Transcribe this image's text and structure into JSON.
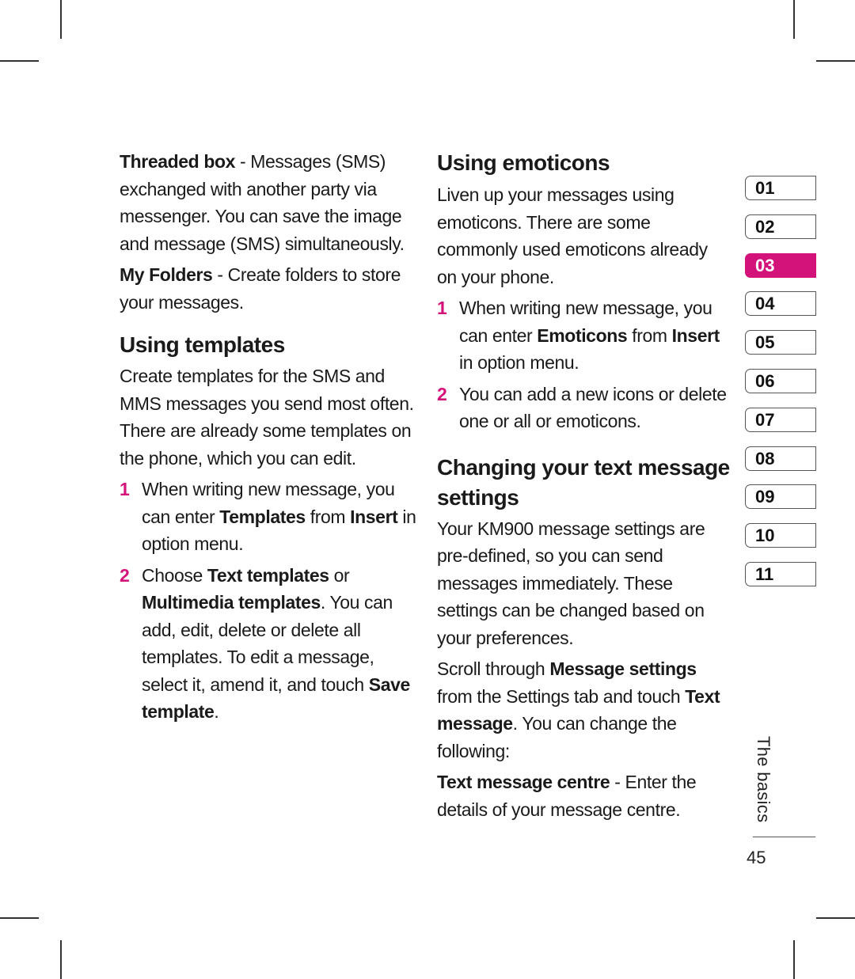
{
  "left_column": {
    "threaded_box": {
      "term": "Threaded box",
      "text": " - Messages (SMS) exchanged with another party via messenger. You can save the image and message (SMS) simultaneously."
    },
    "my_folders": {
      "term": "My Folders",
      "text": " - Create folders to store your messages."
    },
    "templates_heading": "Using templates",
    "templates_intro": "Create templates for the SMS and MMS messages you send most often. There are already some templates on the phone, which you can edit.",
    "steps": [
      {
        "num": "1",
        "a": "When writing new message, you can enter ",
        "b1": "Templates",
        "c": " from ",
        "b2": "Insert",
        "d": " in option menu."
      },
      {
        "num": "2",
        "a": "Choose ",
        "b1": "Text templates",
        "c": " or ",
        "b2": "Multimedia templates",
        "d": ". You can add, edit, delete or delete all templates. To edit a message, select it, amend it, and touch ",
        "b3": "Save template",
        "e": "."
      }
    ]
  },
  "right_column": {
    "emoticons_heading": "Using emoticons",
    "emoticons_intro": "Liven up your messages using emoticons. There are some commonly used emoticons already on your phone.",
    "steps": [
      {
        "num": "1",
        "a": "When writing new message, you can enter ",
        "b1": "Emoticons",
        "c": " from ",
        "b2": "Insert",
        "d": " in option menu."
      },
      {
        "num": "2",
        "a": "You can add a new icons or delete one or all or emoticons."
      }
    ],
    "settings_heading": "Changing your text message settings",
    "settings_intro": "Your KM900 message settings are pre-defined, so you can send messages immediately. These settings can be changed based on your preferences.",
    "scroll": {
      "a": "Scroll through ",
      "b1": "Message settings",
      "c": " from the Settings tab and touch ",
      "b2": "Text message",
      "d": ". You can change the following:"
    },
    "centre": {
      "term": "Text message centre",
      "text": " - Enter the details of your message centre."
    }
  },
  "chapter_tabs": [
    "01",
    "02",
    "03",
    "04",
    "05",
    "06",
    "07",
    "08",
    "09",
    "10",
    "11"
  ],
  "active_tab": "03",
  "accent_color": "#d4137a",
  "section_label": "The basics",
  "page_number": "45"
}
